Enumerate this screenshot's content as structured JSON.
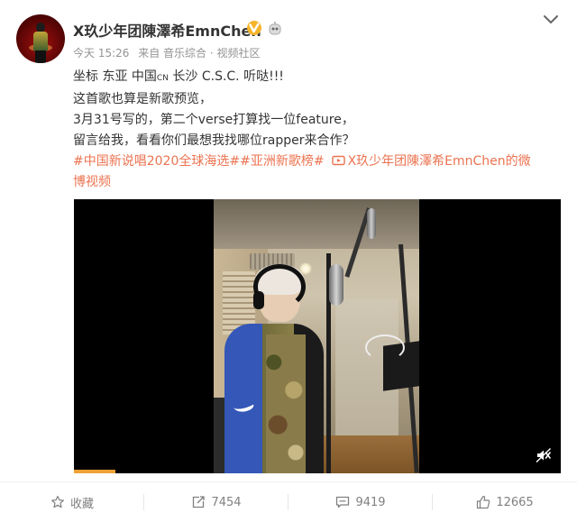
{
  "post": {
    "user": {
      "name": "X玖少年团陳澤希EmnChen",
      "verified_icon": "verified-gold-v-icon",
      "badge_icon": "robot-member-icon"
    },
    "meta": {
      "time": "今天 15:26",
      "source": "来自 音乐综合 · 视频社区"
    },
    "text": {
      "line1_before": "坐标 东亚 中国",
      "line1_small": "CN",
      "line1_after": " 长沙 C.S.C. 听哒!!!",
      "line2": "这首歌也算是新歌预览，",
      "line3": "3月31号写的，第二个verse打算找一位feature，",
      "line4": "留言给我，看看你们最想我找哪位rapper来合作？",
      "tags": "#中国新说唱2020全球海选##亚洲新歌榜#",
      "video_link_part1": "X玖少年团陳澤希EmnChen的微",
      "video_link_part2": "博视频"
    },
    "video": {
      "description_icon": "video-thumbnail",
      "progress": 0.085,
      "mute_icon": "volume-muted-icon"
    }
  },
  "actions": {
    "favorite": {
      "label": "收藏",
      "icon": "star-icon"
    },
    "repost": {
      "count": "7454",
      "icon": "repost-icon"
    },
    "comment": {
      "count": "9419",
      "icon": "comment-icon"
    },
    "like": {
      "count": "12665",
      "icon": "thumbs-up-icon"
    }
  },
  "colors": {
    "link": "#eb7350",
    "meta": "#939393",
    "text": "#333333",
    "action": "#808080",
    "progress": "#f0a136"
  }
}
